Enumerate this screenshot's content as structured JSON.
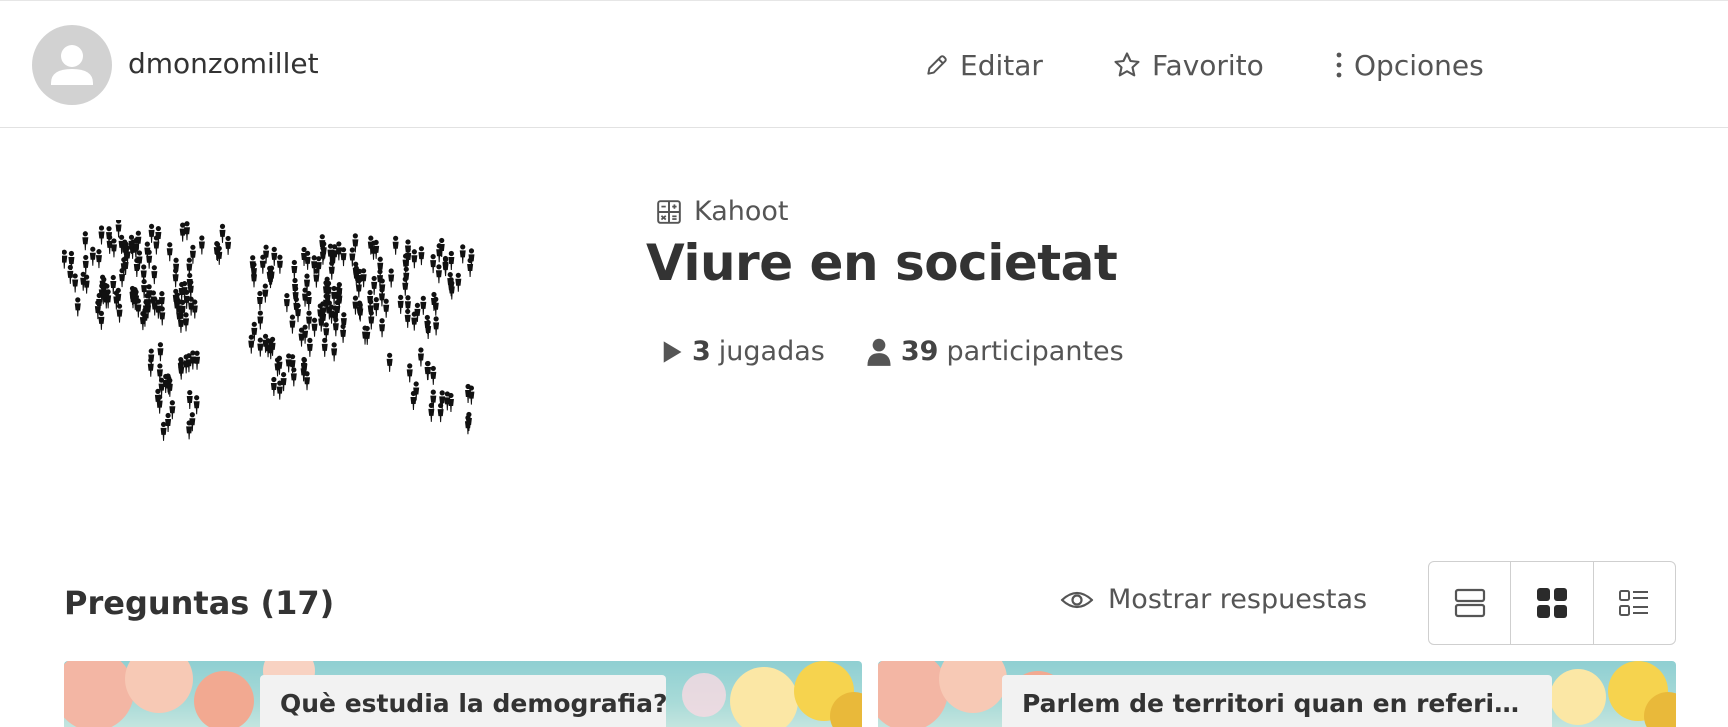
{
  "header": {
    "username": "dmonzomillet",
    "actions": {
      "edit": "Editar",
      "favorite": "Favorito",
      "options": "Opciones"
    }
  },
  "kahoot": {
    "type_label": "Kahoot",
    "title": "Viure en societat",
    "plays_count": "3",
    "plays_label": "jugadas",
    "participants_count": "39",
    "participants_label": "participantes",
    "cover_image": "world-map-of-people-illustration"
  },
  "questions": {
    "heading": "Preguntas (17)",
    "show_answers": "Mostrar respuestas",
    "view_modes": [
      "rows-view-icon",
      "grid-view-icon",
      "list-view-icon"
    ],
    "active_view": "grid",
    "cards": [
      {
        "title": "Què estudia la demografia?"
      },
      {
        "title": "Parlem de territori quan en referim a..."
      }
    ]
  },
  "colors": {
    "text": "#333333",
    "muted": "#555555",
    "avatar_bg": "#d2d2d2",
    "border": "#cfcfcf"
  }
}
